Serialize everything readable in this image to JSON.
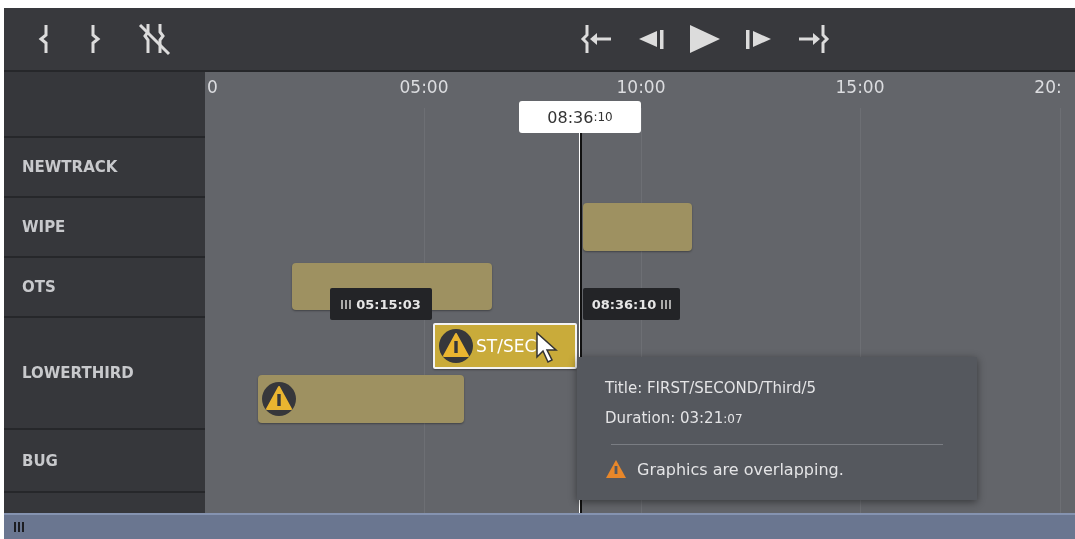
{
  "ruler": {
    "ticks": [
      "0",
      "05:00",
      "10:00",
      "15:00",
      "20:"
    ]
  },
  "playhead": {
    "time": "08:36",
    "frames": ":10"
  },
  "tracks": [
    {
      "name": "NEWTRACK"
    },
    {
      "name": "WIPE",
      "clips": [
        {
          "selected": false,
          "warning": false
        }
      ]
    },
    {
      "name": "OTS",
      "clips": [
        {
          "selected": false,
          "warning": false
        }
      ]
    },
    {
      "name": "LOWERTHIRD",
      "clips": [
        {
          "label": "ST/SEC",
          "selected": true,
          "warning": true
        },
        {
          "selected": false,
          "warning": true
        }
      ]
    },
    {
      "name": "BUG"
    }
  ],
  "trim_labels": [
    {
      "text": "05:15:03",
      "kind": "in"
    },
    {
      "text": "08:36:10",
      "kind": "out"
    }
  ],
  "tooltip": {
    "title": "Title: FIRST/SECOND/Third/5",
    "duration": "Duration: 03:21",
    "duration_frames": ":07",
    "warning": "Graphics are overlapping."
  }
}
